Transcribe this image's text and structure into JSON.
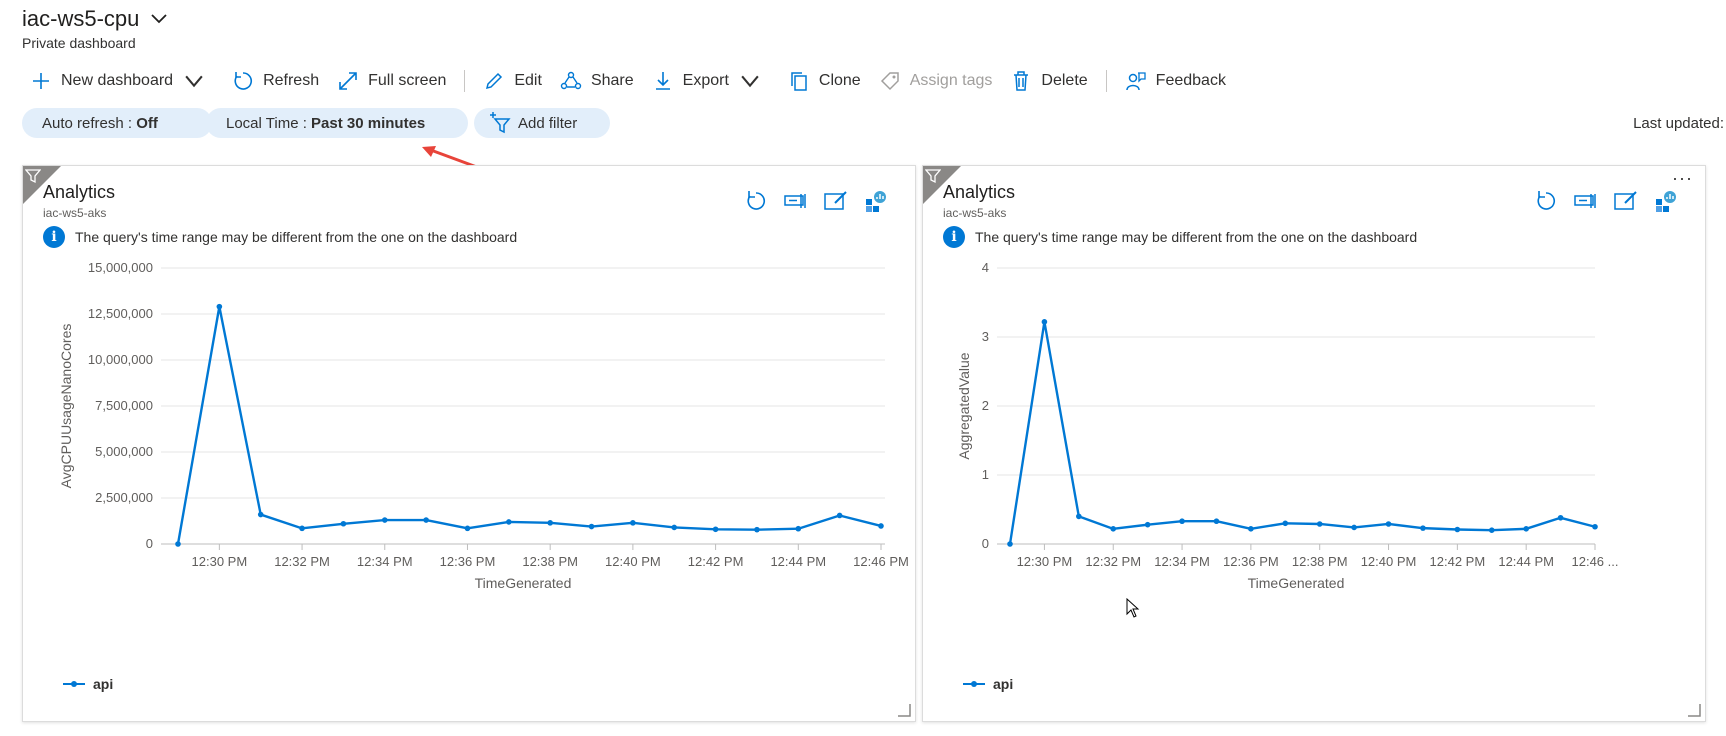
{
  "dashboard": {
    "title": "iac-ws5-cpu",
    "subtitle": "Private dashboard"
  },
  "toolbar": {
    "new_dashboard": "New dashboard",
    "refresh": "Refresh",
    "full_screen": "Full screen",
    "edit": "Edit",
    "share": "Share",
    "export": "Export",
    "clone": "Clone",
    "assign_tags": "Assign tags",
    "delete": "Delete",
    "feedback": "Feedback"
  },
  "filters": {
    "auto_refresh_label": "Auto refresh :",
    "auto_refresh_value": "Off",
    "time_label": "Local Time :",
    "time_value": "Past 30 minutes",
    "add_filter": "Add filter"
  },
  "last_updated": "Last updated:",
  "colors": {
    "accent": "#0078d4",
    "pill_bg": "#e2eefa",
    "arrow": "#e8443a"
  },
  "tiles": [
    {
      "title": "Analytics",
      "subtitle": "iac-ws5-aks",
      "info": "The query's time range may be different from the one on the dashboard",
      "legend": "api"
    },
    {
      "title": "Analytics",
      "subtitle": "iac-ws5-aks",
      "info": "The query's time range may be different from the one on the dashboard",
      "legend": "api"
    }
  ],
  "chart_data": [
    {
      "type": "line",
      "xlabel": "TimeGenerated",
      "ylabel": "AvgCPUUsageNanoCores",
      "x": [
        "12:29 PM",
        "12:30 PM",
        "12:31 PM",
        "12:32 PM",
        "12:33 PM",
        "12:34 PM",
        "12:35 PM",
        "12:36 PM",
        "12:37 PM",
        "12:38 PM",
        "12:39 PM",
        "12:40 PM",
        "12:41 PM",
        "12:42 PM",
        "12:43 PM",
        "12:44 PM",
        "12:45 PM",
        "12:46 PM"
      ],
      "x_ticks": [
        "12:30 PM",
        "12:32 PM",
        "12:34 PM",
        "12:36 PM",
        "12:38 PM",
        "12:40 PM",
        "12:42 PM",
        "12:44 PM",
        "12:46 PM"
      ],
      "y_ticks": [
        "15,000,000",
        "12,500,000",
        "10,000,000",
        "7,500,000",
        "5,000,000",
        "2,500,000",
        "0"
      ],
      "ylim": [
        0,
        15000000
      ],
      "series": [
        {
          "name": "api",
          "values": [
            0,
            12900000,
            1600000,
            850000,
            1100000,
            1300000,
            1300000,
            850000,
            1200000,
            1150000,
            950000,
            1150000,
            900000,
            800000,
            780000,
            830000,
            1550000,
            980000
          ]
        }
      ]
    },
    {
      "type": "line",
      "xlabel": "TimeGenerated",
      "ylabel": "AggregatedValue",
      "x": [
        "12:29 PM",
        "12:30 PM",
        "12:31 PM",
        "12:32 PM",
        "12:33 PM",
        "12:34 PM",
        "12:35 PM",
        "12:36 PM",
        "12:37 PM",
        "12:38 PM",
        "12:39 PM",
        "12:40 PM",
        "12:41 PM",
        "12:42 PM",
        "12:43 PM",
        "12:44 PM",
        "12:45 PM",
        "12:46 PM"
      ],
      "x_ticks": [
        "12:30 PM",
        "12:32 PM",
        "12:34 PM",
        "12:36 PM",
        "12:38 PM",
        "12:40 PM",
        "12:42 PM",
        "12:44 PM",
        "12:46 ..."
      ],
      "y_ticks": [
        "4",
        "3",
        "2",
        "1",
        "0"
      ],
      "ylim": [
        0,
        4
      ],
      "series": [
        {
          "name": "api",
          "values": [
            0,
            3.22,
            0.4,
            0.22,
            0.28,
            0.33,
            0.33,
            0.22,
            0.3,
            0.29,
            0.24,
            0.29,
            0.23,
            0.21,
            0.2,
            0.22,
            0.38,
            0.25
          ]
        }
      ]
    }
  ]
}
